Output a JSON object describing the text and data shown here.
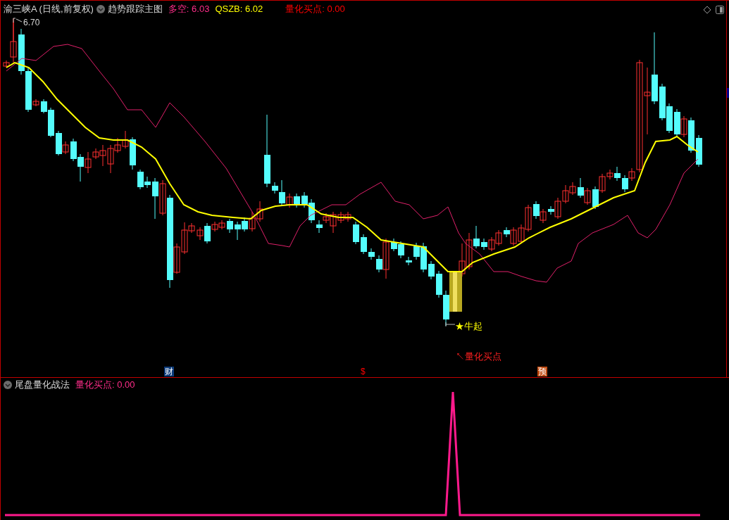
{
  "header": {
    "stock": "渝三峡A (日线,前复权)",
    "indicator": "趋势跟踪主图",
    "readings": [
      {
        "text": "多空: 6.03",
        "color": "#ff2d8a"
      },
      {
        "text": "QSZB: 6.02",
        "color": "#ffff00"
      },
      {
        "text": "量化买点: 0.00",
        "color": "#ff0000"
      }
    ]
  },
  "price_label": "6.70",
  "signal_label": "★牛起",
  "buy_label": "↖量化买点",
  "event_markers": [
    {
      "text": "财",
      "kind": "finance"
    },
    {
      "text": "$",
      "kind": "dividend"
    },
    {
      "text": "预",
      "kind": "forecast"
    }
  ],
  "lower_panel": {
    "title": "尾盘量化战法",
    "reading": "量化买点: 0.00"
  }
}
